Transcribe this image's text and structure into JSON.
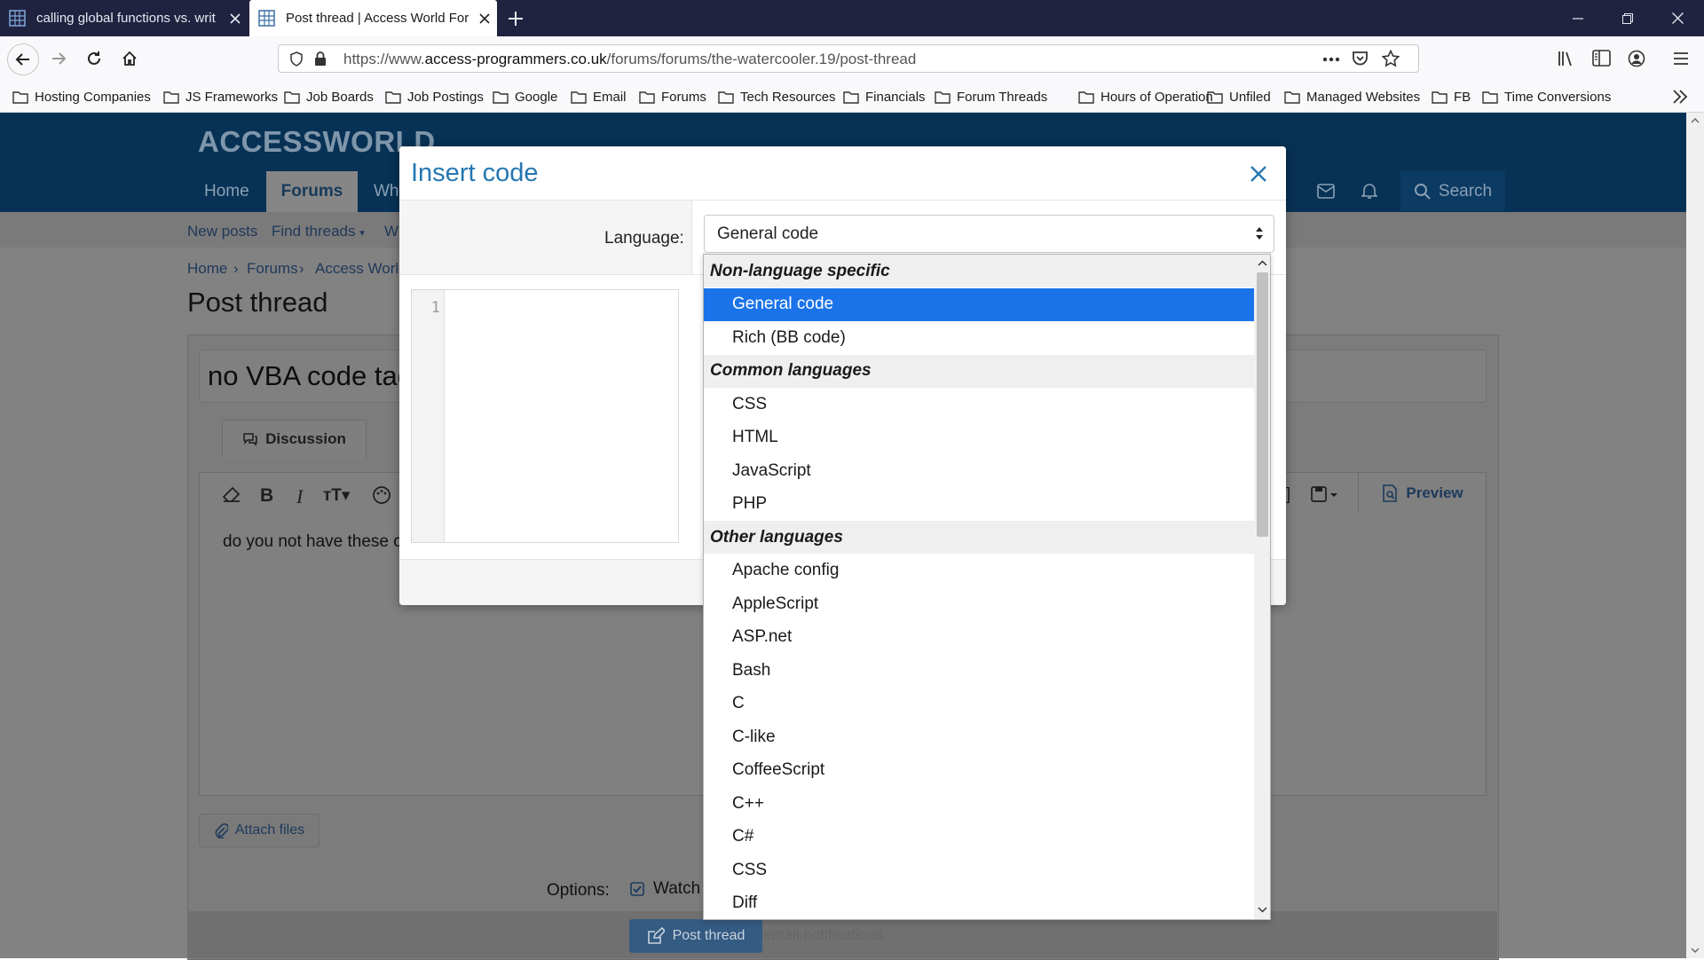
{
  "browser": {
    "tabs": [
      {
        "title": "calling global functions vs. writ",
        "active": false
      },
      {
        "title": "Post thread | Access World For",
        "active": true
      }
    ],
    "url_prefix": "https://www.",
    "url_domain": "access-programmers.co.uk",
    "url_path": "/forums/forums/the-watercooler.19/post-thread",
    "bookmarks": [
      "Hosting Companies",
      "JS Frameworks",
      "Job Boards",
      "Job Postings",
      "Google",
      "Email",
      "Forums",
      "Tech Resources",
      "Financials",
      "Forum Threads",
      "Hours of Operation",
      "Unfiled",
      "Managed Websites",
      "FB",
      "Time Conversions"
    ]
  },
  "site": {
    "logo": "ACCESSWORLD",
    "nav": {
      "home": "Home",
      "forums": "Forums",
      "whats_new": "Wh",
      "search": "Search"
    },
    "subnav": {
      "new_posts": "New posts",
      "find_threads": "Find threads",
      "watched": "W"
    },
    "breadcrumb": [
      "Home",
      "Forums",
      "Access World"
    ],
    "page_title": "Post thread",
    "thread_title": "no VBA code tag",
    "discussion_tab": "Discussion",
    "body_text": "do you not have these c",
    "preview": "Preview",
    "attach": "Attach files",
    "options_label": "Options:",
    "watch": "Watch",
    "post_button": "Post thread",
    "email_note": "email notifications"
  },
  "modal": {
    "title": "Insert code",
    "language_label": "Language:",
    "language_value": "General code",
    "line_number": "1"
  },
  "dropdown": {
    "groups": [
      {
        "label": "Non-language specific",
        "options": [
          "General code",
          "Rich (BB code)"
        ]
      },
      {
        "label": "Common languages",
        "options": [
          "CSS",
          "HTML",
          "JavaScript",
          "PHP"
        ]
      },
      {
        "label": "Other languages",
        "options": [
          "Apache config",
          "AppleScript",
          "ASP.net",
          "Bash",
          "C",
          "C-like",
          "CoffeeScript",
          "C++",
          "C#",
          "CSS",
          "Diff"
        ]
      }
    ],
    "selected": "General code"
  },
  "colors": {
    "accent": "#2577b1",
    "selected": "#1a73e8",
    "site_header": "#073255"
  }
}
